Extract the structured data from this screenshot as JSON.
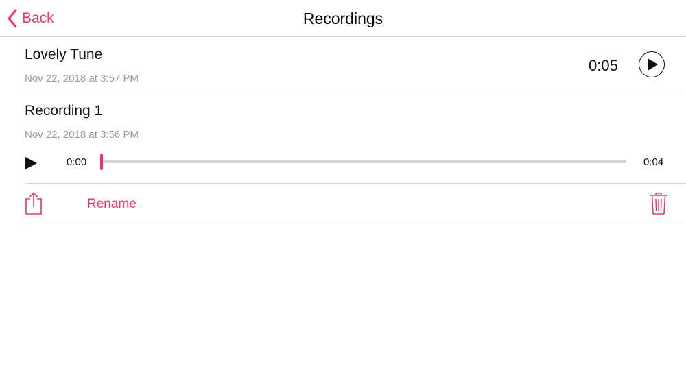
{
  "nav": {
    "back_label": "Back",
    "title": "Recordings"
  },
  "recordings": [
    {
      "title": "Lovely Tune",
      "date": "Nov 22, 2018 at 3:57 PM",
      "duration": "0:05"
    },
    {
      "title": "Recording 1",
      "date": "Nov 22, 2018 at 3:56 PM",
      "player": {
        "current_time": "0:00",
        "end_time": "0:04",
        "progress": 0.0
      }
    }
  ],
  "actions": {
    "rename_label": "Rename",
    "share_icon": "share-icon",
    "trash_icon": "trash-icon"
  },
  "colors": {
    "accent": "#f2355b",
    "separator": "#dcdcdc",
    "secondary_text": "#9a9a9a"
  }
}
